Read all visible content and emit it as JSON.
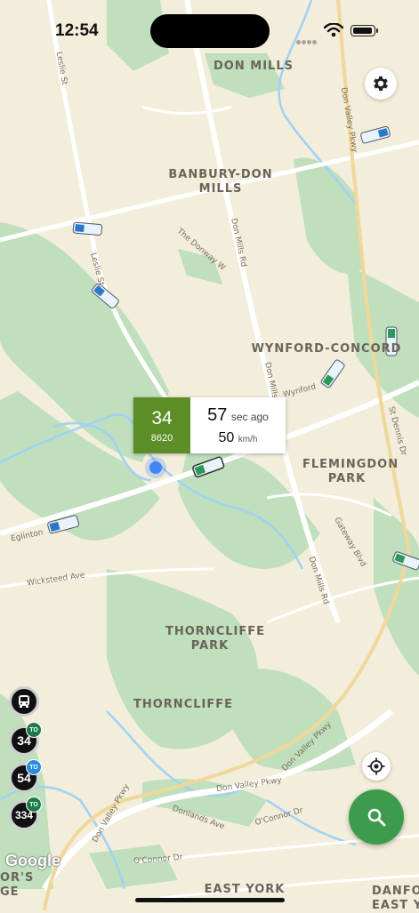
{
  "status_bar": {
    "time": "12:54"
  },
  "map": {
    "areas": [
      {
        "id": "don-mills",
        "text": "DON MILLS"
      },
      {
        "id": "banbury",
        "text": "BANBURY-DON\nMILLS"
      },
      {
        "id": "wynford",
        "text": "WYNFORD-CONCORD"
      },
      {
        "id": "flemingdon",
        "text": "FLEMINGDON\nPARK"
      },
      {
        "id": "thorncliffe-park",
        "text": "THORNCLIFFE\nPARK"
      },
      {
        "id": "thorncliffe",
        "text": "THORNCLIFFE"
      },
      {
        "id": "east-york",
        "text": "EAST YORK"
      },
      {
        "id": "danforth",
        "text": "DANFO\nEAST Y"
      },
      {
        "id": "leaside-edge",
        "text": "OR'S\nGE"
      }
    ],
    "streets": [
      {
        "id": "leslie-st-top",
        "text": "Leslie St"
      },
      {
        "id": "leslie-st",
        "text": "Leslie St"
      },
      {
        "id": "donway-w",
        "text": "The Donway W"
      },
      {
        "id": "don-mills-rd",
        "text": "Don Mills Rd"
      },
      {
        "id": "don-mills-rd-2",
        "text": "Don Mills Rd"
      },
      {
        "id": "don-mills-rd-3",
        "text": "Don Mills Rd"
      },
      {
        "id": "dvp-top",
        "text": "Don Valley Pkwy"
      },
      {
        "id": "wynford-dr",
        "text": "Wynford"
      },
      {
        "id": "st-dennis",
        "text": "St Dennis Dr"
      },
      {
        "id": "eglinton",
        "text": "Eglinton"
      },
      {
        "id": "gateway",
        "text": "Gateway Blvd"
      },
      {
        "id": "wicksteed",
        "text": "Wicksteed Ave"
      },
      {
        "id": "dvp-right",
        "text": "Don Valley Pkwy"
      },
      {
        "id": "dvp-bottom",
        "text": "Don Valley Pkwy"
      },
      {
        "id": "dvp-left",
        "text": "Don Valley Pkwy"
      },
      {
        "id": "donlands",
        "text": "Donlands Ave"
      },
      {
        "id": "oconnor",
        "text": "O'Connor Dr"
      },
      {
        "id": "oconnor-2",
        "text": "O'Connor Dr"
      }
    ],
    "attribution": "Google"
  },
  "vehicle_popup": {
    "route": "34",
    "vehicle_id": "8620",
    "seconds": "57",
    "seconds_unit": "sec ago",
    "speed": "50",
    "speed_unit": "km/h",
    "color": "#5c8d26"
  },
  "route_buttons": [
    {
      "label": "",
      "icon": "bus-icon",
      "badge": ""
    },
    {
      "label": "34",
      "badge": "TO",
      "badge_color": "#1d7a4a"
    },
    {
      "label": "54",
      "badge": "TO",
      "badge_color": "#2b8ae0"
    },
    {
      "label": "334",
      "badge": "TO",
      "badge_color": "#1d7a4a"
    }
  ],
  "colors": {
    "map_bg": "#f3eddc",
    "park": "#b9dcb8",
    "water": "#9fd2f3",
    "fab": "#3c9c4c"
  }
}
